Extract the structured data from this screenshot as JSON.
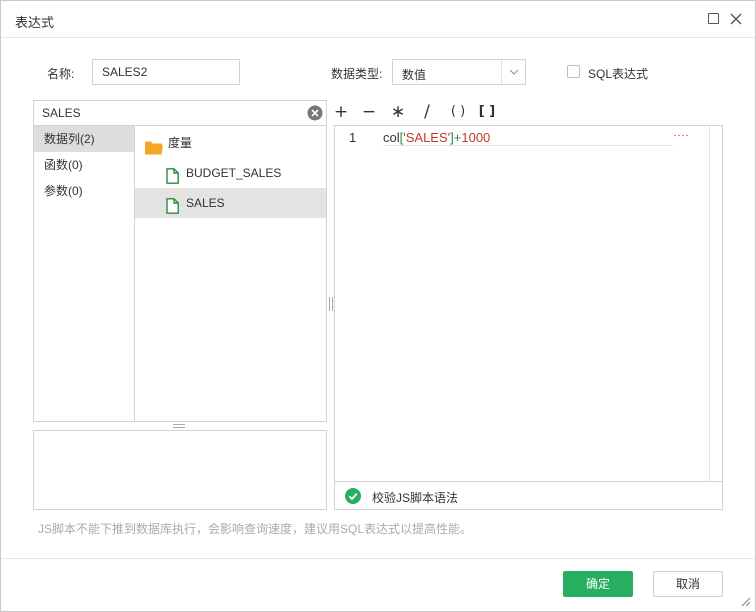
{
  "dialog": {
    "title": "表达式",
    "maximize_icon": "maximize-icon",
    "close_icon": "close-icon"
  },
  "form": {
    "name_label": "名称:",
    "name_value": "SALES2",
    "type_label": "数据类型:",
    "type_value": "数值",
    "sql_label": "SQL表达式",
    "sql_checked": false
  },
  "search": {
    "value": "SALES"
  },
  "categories": [
    {
      "label": "数据列(2)",
      "active": true
    },
    {
      "label": "函数(0)",
      "active": false
    },
    {
      "label": "参数(0)",
      "active": false
    }
  ],
  "tree": {
    "folder": "度量",
    "fields": [
      {
        "label": "BUDGET_SALES",
        "selected": false
      },
      {
        "label": "SALES",
        "selected": true
      }
    ]
  },
  "operators": [
    "+",
    "−",
    "∗",
    "/",
    "( )",
    "[ ]"
  ],
  "editor": {
    "line_number": "1",
    "tokens": {
      "fn": "col",
      "open": "[",
      "str": "'SALES'",
      "close": "]",
      "op": "+",
      "num": "1000"
    }
  },
  "validate": {
    "label": "校验JS脚本语法"
  },
  "hint": "JS脚本不能下推到数据库执行，会影响查询速度，建议用SQL表达式以提高性能。",
  "buttons": {
    "ok": "确定",
    "cancel": "取消"
  },
  "colors": {
    "accent": "#27ae60",
    "folder": "#f5a623",
    "field_icon": "#2e8b3a"
  }
}
